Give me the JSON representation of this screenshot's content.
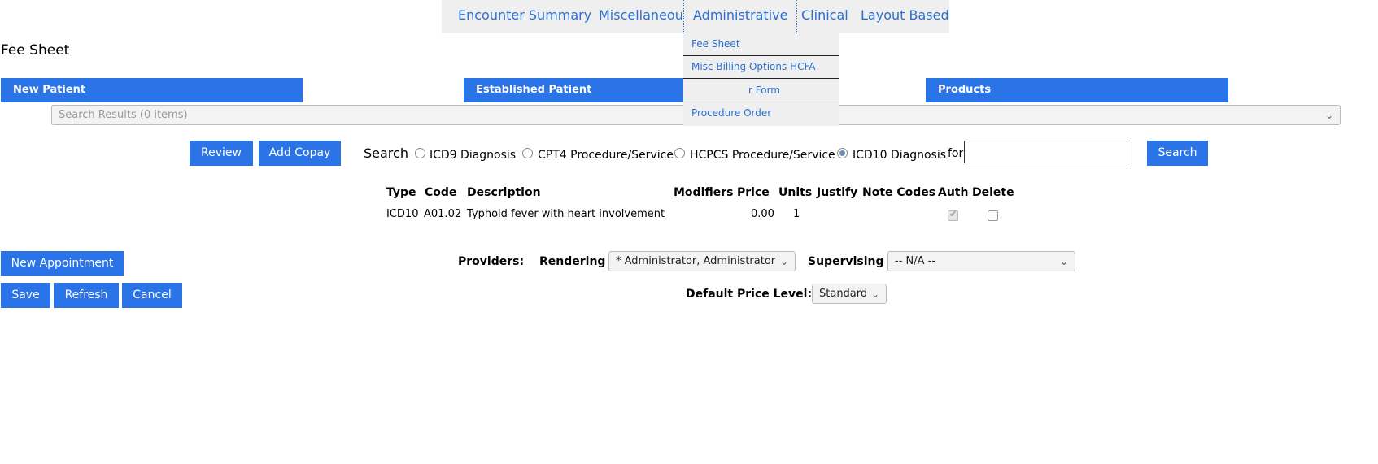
{
  "nav": {
    "tabs": [
      "Encounter Summary",
      "Miscellaneous",
      "Administrative",
      "Clinical",
      "Layout Based"
    ],
    "dropdown": [
      "Fee Sheet",
      "Misc Billing Options HCFA",
      "r Form",
      "Procedure Order"
    ]
  },
  "page_title": "Fee Sheet",
  "categories": [
    "New Patient",
    "Established Patient",
    "Products"
  ],
  "search_results_placeholder": "Search Results (0 items)",
  "buttons": {
    "review": "Review",
    "add_copay": "Add Copay",
    "search": "Search",
    "new_appointment": "New Appointment",
    "save": "Save",
    "refresh": "Refresh",
    "cancel": "Cancel"
  },
  "search": {
    "label": "Search",
    "options": [
      "ICD9 Diagnosis",
      "CPT4 Procedure/Service",
      "HCPCS Procedure/Service",
      "ICD10 Diagnosis"
    ],
    "selected": "ICD10 Diagnosis",
    "for_label": "for",
    "value": ""
  },
  "table": {
    "headers": [
      "Type",
      "Code",
      "Description",
      "Modifiers",
      "Price",
      "Units",
      "Justify",
      "Note Codes",
      "Auth",
      "Delete"
    ],
    "rows": [
      {
        "type": "ICD10",
        "code": "A01.02",
        "description": "Typhoid fever with heart involvement",
        "price": "0.00",
        "units": "1",
        "auth": true,
        "delete": false
      }
    ]
  },
  "providers": {
    "label": "Providers:",
    "rendering_label": "Rendering",
    "rendering_value": "* Administrator, Administrator",
    "supervising_label": "Supervising",
    "supervising_value": "-- N/A --",
    "price_level_label": "Default Price Level:",
    "price_level_value": "Standard"
  },
  "colors": {
    "accent": "#2a74e8",
    "link": "#2a6fd1",
    "nav_bg": "#efefef"
  }
}
